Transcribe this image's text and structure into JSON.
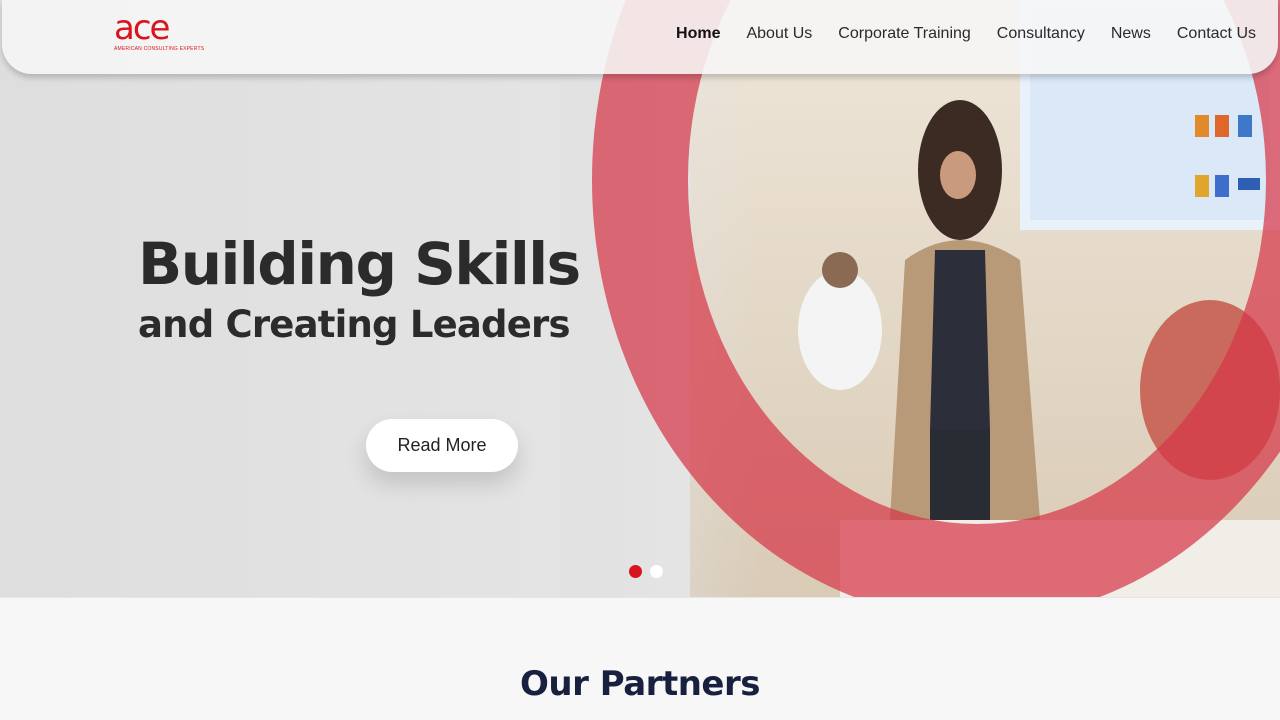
{
  "brand": {
    "logo_text": "ace",
    "tagline": "AMERICAN CONSULTING EXPERTS",
    "color": "#d8141e"
  },
  "nav": {
    "items": [
      {
        "label": "Home",
        "active": true
      },
      {
        "label": "About Us",
        "active": false
      },
      {
        "label": "Corporate Training",
        "active": false
      },
      {
        "label": "Consultancy",
        "active": false
      },
      {
        "label": "News",
        "active": false
      },
      {
        "label": "Contact Us",
        "active": false
      }
    ]
  },
  "hero": {
    "headline_line1": "Building Skills",
    "headline_line2": "and Creating Leaders",
    "cta_label": "Read More",
    "slides_total": 2,
    "active_slide": 1,
    "accent_color": "#d63748"
  },
  "partners": {
    "title": "Our Partners"
  }
}
